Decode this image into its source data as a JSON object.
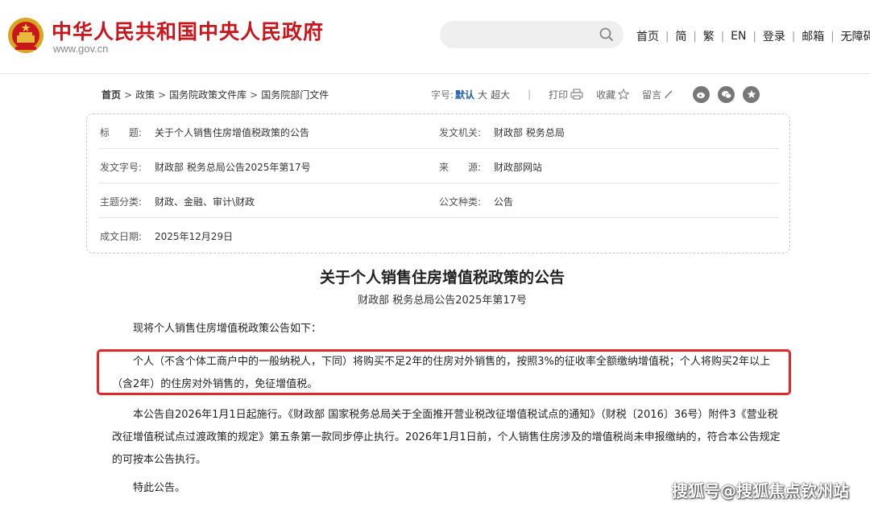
{
  "header": {
    "site_title": "中华人民共和国中央人民政府",
    "site_url": "www.gov.cn",
    "nav": [
      "首页",
      "简",
      "繁",
      "EN",
      "登录",
      "邮箱",
      "无障碍"
    ]
  },
  "breadcrumb": [
    "首页",
    "政策",
    "国务院政策文件库",
    "国务院部门文件"
  ],
  "toolbar": {
    "font_label": "字号:",
    "font_default": "默认",
    "font_large": "大",
    "font_xlarge": "超大",
    "print": "打印",
    "favorite": "收藏",
    "comment": "留言"
  },
  "meta": {
    "rows": [
      {
        "l1": "标　　题:",
        "v1": "关于个人销售住房增值税政策的公告",
        "l2": "发文机关:",
        "v2": "财政部 税务总局"
      },
      {
        "l1": "发文字号:",
        "v1": "财政部 税务总局公告2025年第17号",
        "l2": "来　　源:",
        "v2": "财政部网站"
      },
      {
        "l1": "主题分类:",
        "v1": "财政、金融、审计\\财政",
        "l2": "公文种类:",
        "v2": "公告"
      },
      {
        "l1": "成文日期:",
        "v1": "2025年12月29日"
      }
    ]
  },
  "article": {
    "title": "关于个人销售住房增值税政策的公告",
    "subtitle": "财政部 税务总局公告2025年第17号",
    "paragraphs": [
      "现将个人销售住房增值税政策公告如下：",
      "个人（不含个体工商户中的一般纳税人，下同）将购买不足2年的住房对外销售的，按照3%的征收率全额缴纳增值税；个人将购买2年以上（含2年）的住房对外销售的，免征增值税。",
      "本公告自2026年1月1日起施行。《财政部 国家税务总局关于全面推开营业税改征增值税试点的通知》（财税〔2016〕36号）附件3《营业税改征增值税试点过渡政策的规定》第五条第一款同步停止执行。2026年1月1日前，个人销售住房涉及的增值税尚未申报缴纳的，符合本公告规定的可按本公告执行。",
      "特此公告。"
    ]
  },
  "watermark": "搜狐号@搜狐焦点钦州站",
  "colors": {
    "brand_red": "#c9161d",
    "highlight_red": "#e3262a",
    "link_blue": "#1f5fae"
  }
}
